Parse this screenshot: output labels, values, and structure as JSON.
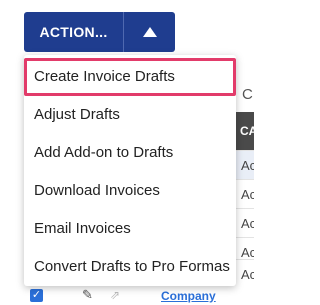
{
  "action_button": {
    "label": "ACTION...",
    "caret_icon": "caret-up-icon",
    "color": "#1f3d8f"
  },
  "menu": {
    "items": [
      {
        "label": "Create Invoice Drafts"
      },
      {
        "label": "Adjust Drafts"
      },
      {
        "label": "Add Add-on to Drafts"
      },
      {
        "label": "Download Invoices"
      },
      {
        "label": "Email Invoices"
      },
      {
        "label": "Convert Drafts to Pro Formas"
      }
    ],
    "focus_color": "#e23b6a"
  },
  "background_table": {
    "subheader_text": "C",
    "header_text": "CA",
    "cells": [
      "Ac",
      "Ac",
      "Ac",
      "Ac",
      "Ac"
    ],
    "bottom_row": {
      "link_text": "Company"
    }
  }
}
